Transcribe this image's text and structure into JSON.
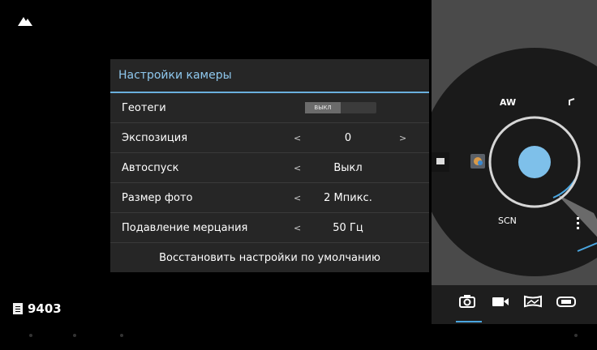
{
  "counter": {
    "value": "9403"
  },
  "settings": {
    "title": "Настройки камеры",
    "geotags": {
      "label": "Геотеги",
      "toggle_text": "ВЫКЛ"
    },
    "exposure": {
      "label": "Экспозиция",
      "value": "0",
      "prev": "<",
      "next": ">"
    },
    "timer": {
      "label": "Автоспуск",
      "value": "Выкл",
      "prev": "<"
    },
    "photo_size": {
      "label": "Размер фото",
      "value": "2 Мпикс.",
      "prev": "<"
    },
    "flicker": {
      "label": "Подавление мерцания",
      "value": "50 Гц",
      "prev": "<"
    },
    "reset_label": "Восстановить настройки по умолчанию"
  },
  "controls": {
    "scene_mode": "SCN",
    "white_balance": "AW"
  },
  "colors": {
    "accent": "#6ab0dd",
    "shutter": "#7ec0ea",
    "panel": "#4a4a4a",
    "dialog": "#262626"
  },
  "icons": {
    "top": "mountain-icon",
    "counter": "sd-card-icon",
    "modes": [
      "camera-icon",
      "video-icon",
      "panorama-icon",
      "wide-panorama-icon"
    ],
    "pie": [
      "white-balance-icon",
      "settings-arc-icon",
      "more-icon",
      "effects-icon",
      "gallery-icon"
    ]
  }
}
